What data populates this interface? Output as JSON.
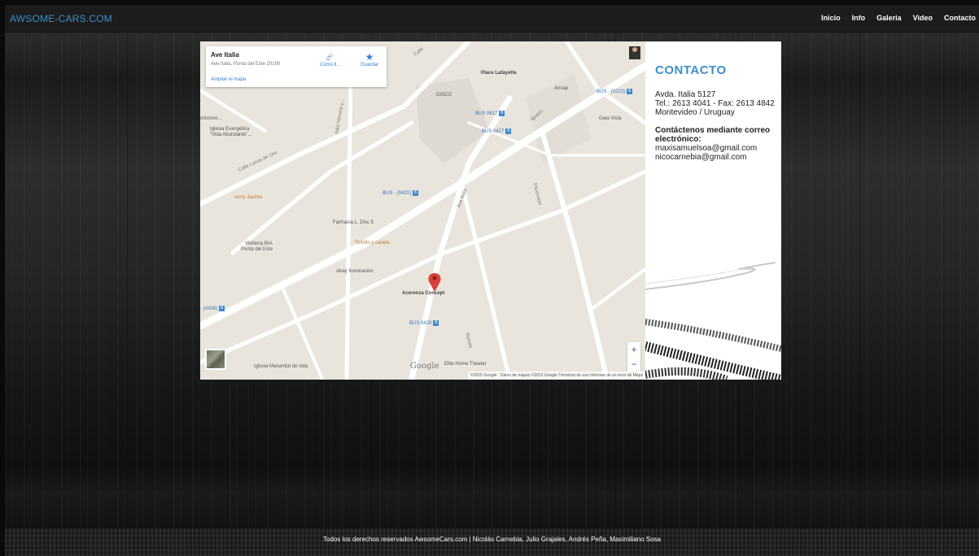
{
  "header": {
    "brand": "AWSOME-CARS.COM",
    "nav": [
      "Inicio",
      "Info",
      "Galeria",
      "Video",
      "Contacto"
    ]
  },
  "map": {
    "place_title": "Ave Italia",
    "place_address": "Ave Italia, Punta del Este 20100",
    "enlarge_link": "Ampliar el mapa",
    "directions_label": "Cómo ll...",
    "save_label": "Guardar",
    "labels": {
      "place_lafayette": "Place Lafayette",
      "disco": "DISCO",
      "ancap": "Ancap",
      "gala_vista": "Gala Vista",
      "exclusivo": "xclusivo...",
      "iglesia_1": "Iglesia Evangélica",
      "iglesia_2": "\"Vida Abundante\"...",
      "calle_lunas": "Calle Lunas de Oro",
      "sorry_jacinta": "sorry Jacinta",
      "farmacia": "Farmacia L. Disc 5",
      "tomillo": "Tomillo y canela",
      "vidrieria_1": "Vidriería BIA",
      "vidrieria_2": "Punta del Este",
      "abay": "Abay Iluminación",
      "acerenza": "Acerenza Concept",
      "elite": "Elite Home Theater",
      "iglesia_manantial": "Iglesia Manantial de vida",
      "julio_herrera": "Julio Herrera y...",
      "iguazu": "Iguazú",
      "ave_italia_road": "Ave Italia",
      "pitcomayo": "Pilcomayo",
      "romas": "Romas",
      "calle_road": "Calle"
    },
    "bus_stops": {
      "b0223": "BUS - (0223)",
      "b0617": "BUS 0617",
      "b0427": "BUS 0427",
      "b0420": "BUS - (0420)",
      "b0428": "- (0428)",
      "b0429": "BUS 0429"
    },
    "google": "Google",
    "attribution": "©2015 Google · Datos de mapas ©2015 Google    Términos de uso    Informar de un error de Maps",
    "zoom_in": "+",
    "zoom_out": "−"
  },
  "contact": {
    "heading": "CONTACTO",
    "address": "Avda. Italia 5127",
    "phone": "Tel.: 2613 4041 - Fax: 2613 4842",
    "city": "Montevideo / Uruguay",
    "email_heading": "Contáctenos mediante correo electrónico:",
    "email_1": "maxisamuelsoa@gmail.com",
    "email_2": "nicocarnebia@gmail.com"
  },
  "footer": {
    "text": "Todos los derechos reservados AwsomeCars.com | Nicolás Carnebia, Julio Grajales, Andrés Peña, Maximiliano Sosa"
  },
  "colors": {
    "brand": "#3b8fc6",
    "accent_link": "#3a7bd5",
    "pin": "#d9423a",
    "map_bg": "#e9e5dc",
    "road": "#ffffff"
  }
}
